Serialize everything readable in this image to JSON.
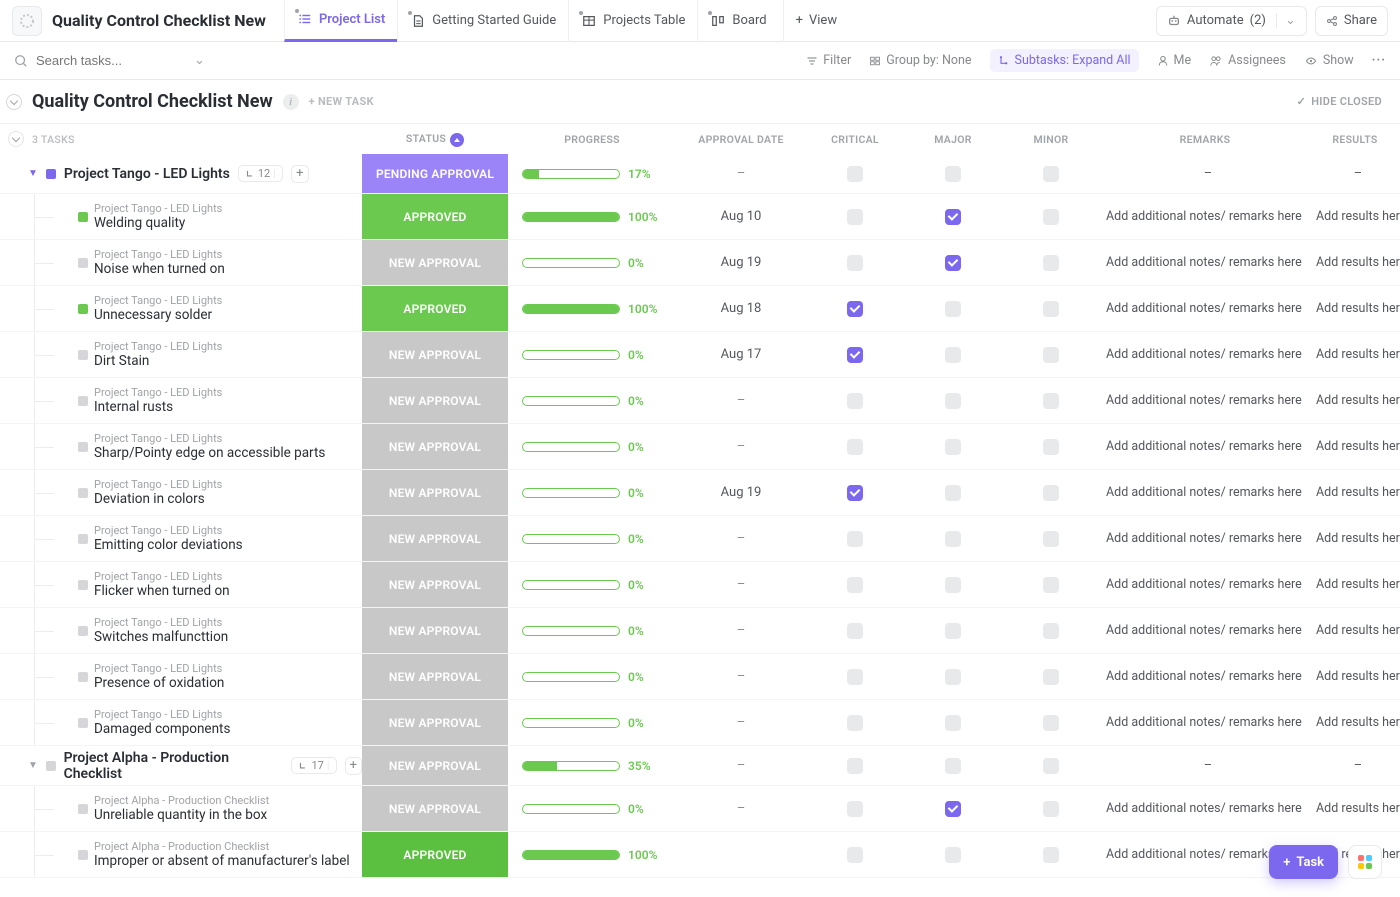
{
  "header": {
    "title": "Quality Control Checklist New",
    "views": [
      {
        "label": "Project List",
        "active": true,
        "icon": "list"
      },
      {
        "label": "Getting Started Guide",
        "active": false,
        "icon": "doc"
      },
      {
        "label": "Projects Table",
        "active": false,
        "icon": "table"
      },
      {
        "label": "Board",
        "active": false,
        "icon": "board"
      }
    ],
    "add_view": "View",
    "automate": {
      "label": "Automate",
      "count": "(2)"
    },
    "share": "Share"
  },
  "toolbar": {
    "search_placeholder": "Search tasks...",
    "filter": "Filter",
    "group_by": "Group by: None",
    "subtasks": "Subtasks: Expand All",
    "me": "Me",
    "assignees": "Assignees",
    "show": "Show"
  },
  "section": {
    "title": "Quality Control Checklist New",
    "new_task": "+ NEW TASK",
    "hide_closed": "HIDE CLOSED",
    "task_count": "3 TASKS"
  },
  "columns": [
    "STATUS",
    "PROGRESS",
    "APPROVAL DATE",
    "CRITICAL",
    "MAJOR",
    "MINOR",
    "REMARKS",
    "RESULTS"
  ],
  "placeholders": {
    "remarks": "Add additional notes/ remarks here",
    "results": "Add results here",
    "dash": "–"
  },
  "status_labels": {
    "PENDING": "PENDING APPROVAL",
    "APPROVED": "APPROVED",
    "NEW": "NEW APPROVAL"
  },
  "groups": [
    {
      "name": "Project Tango - LED Lights",
      "color": "#7b68ee",
      "subtask_count": 12,
      "status": "PENDING",
      "progress": 17,
      "tasks": [
        {
          "title": "Welding quality",
          "breadcrumb": "Project Tango - LED Lights",
          "status": "APPROVED",
          "sq": "#6bc950",
          "progress": 100,
          "date": "Aug 10",
          "critical": false,
          "major": true,
          "minor": false
        },
        {
          "title": "Noise when turned on",
          "breadcrumb": "Project Tango - LED Lights",
          "status": "NEW",
          "sq": "#d6d6d8",
          "progress": 0,
          "date": "Aug 19",
          "critical": false,
          "major": true,
          "minor": false
        },
        {
          "title": "Unnecessary solder",
          "breadcrumb": "Project Tango - LED Lights",
          "status": "APPROVED",
          "sq": "#6bc950",
          "progress": 100,
          "date": "Aug 18",
          "critical": true,
          "major": false,
          "minor": false
        },
        {
          "title": "Dirt Stain",
          "breadcrumb": "Project Tango - LED Lights",
          "status": "NEW",
          "sq": "#d6d6d8",
          "progress": 0,
          "date": "Aug 17",
          "critical": true,
          "major": false,
          "minor": false
        },
        {
          "title": "Internal rusts",
          "breadcrumb": "Project Tango - LED Lights",
          "status": "NEW",
          "sq": "#d6d6d8",
          "progress": 0,
          "date": "-",
          "critical": false,
          "major": false,
          "minor": false
        },
        {
          "title": "Sharp/Pointy edge on accessible parts",
          "breadcrumb": "Project Tango - LED Lights",
          "status": "NEW",
          "sq": "#d6d6d8",
          "progress": 0,
          "date": "-",
          "critical": false,
          "major": false,
          "minor": false
        },
        {
          "title": "Deviation in colors",
          "breadcrumb": "Project Tango - LED Lights",
          "status": "NEW",
          "sq": "#d6d6d8",
          "progress": 0,
          "date": "Aug 19",
          "critical": true,
          "major": false,
          "minor": false
        },
        {
          "title": "Emitting color deviations",
          "breadcrumb": "Project Tango - LED Lights",
          "status": "NEW",
          "sq": "#d6d6d8",
          "progress": 0,
          "date": "-",
          "critical": false,
          "major": false,
          "minor": false
        },
        {
          "title": "Flicker when turned on",
          "breadcrumb": "Project Tango - LED Lights",
          "status": "NEW",
          "sq": "#d6d6d8",
          "progress": 0,
          "date": "-",
          "critical": false,
          "major": false,
          "minor": false
        },
        {
          "title": "Switches malfuncttion",
          "breadcrumb": "Project Tango - LED Lights",
          "status": "NEW",
          "sq": "#d6d6d8",
          "progress": 0,
          "date": "-",
          "critical": false,
          "major": false,
          "minor": false
        },
        {
          "title": "Presence of oxidation",
          "breadcrumb": "Project Tango - LED Lights",
          "status": "NEW",
          "sq": "#d6d6d8",
          "progress": 0,
          "date": "-",
          "critical": false,
          "major": false,
          "minor": false
        },
        {
          "title": "Damaged components",
          "breadcrumb": "Project Tango - LED Lights",
          "status": "NEW",
          "sq": "#d6d6d8",
          "progress": 0,
          "date": "-",
          "critical": false,
          "major": false,
          "minor": false
        }
      ]
    },
    {
      "name": "Project Alpha - Production Checklist",
      "color": "#d6d6d8",
      "subtask_count": 17,
      "status": "NEW",
      "progress": 35,
      "tasks": [
        {
          "title": "Unreliable quantity in the box",
          "breadcrumb": "Project Alpha - Production Checklist",
          "status": "NEW",
          "sq": "#d6d6d8",
          "progress": 0,
          "date": "-",
          "critical": false,
          "major": true,
          "minor": false
        },
        {
          "title": "Improper or absent of manufacturer's label",
          "breadcrumb": "Project Alpha - Production Checklist",
          "status": "APPROVED-FULL",
          "sq": "#d6d6d8",
          "progress": 100,
          "date": "",
          "critical": false,
          "major": false,
          "minor": false
        }
      ]
    }
  ],
  "fab": {
    "label": "Task"
  }
}
